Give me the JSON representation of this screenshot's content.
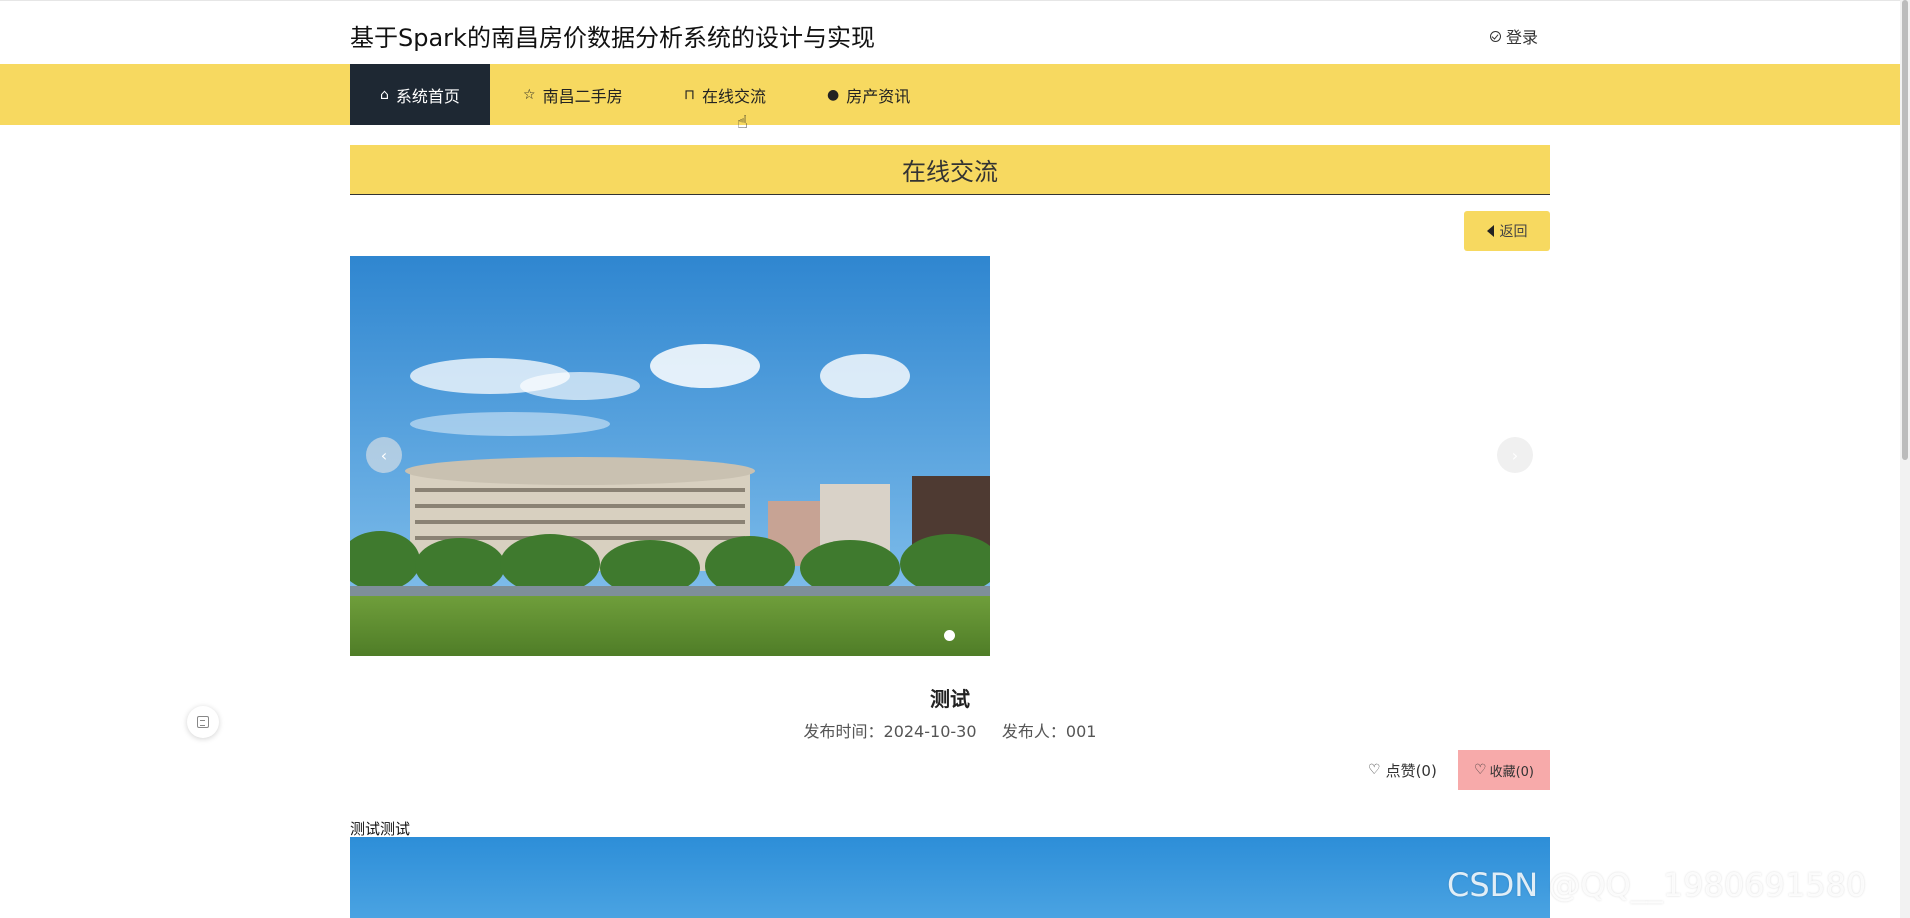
{
  "header": {
    "site_title": "基于Spark的南昌房价数据分析系统的设计与实现",
    "login_label": "登录"
  },
  "nav": {
    "items": [
      {
        "label": "系统首页",
        "icon": "home-icon",
        "active": true
      },
      {
        "label": "南昌二手房",
        "icon": "star-icon",
        "active": false
      },
      {
        "label": "在线交流",
        "icon": "lock-icon",
        "active": false
      },
      {
        "label": "房产资讯",
        "icon": "info-icon",
        "active": false
      }
    ]
  },
  "section": {
    "title": "在线交流",
    "back_label": "返回"
  },
  "carousel": {
    "image": "campus-building-photo",
    "prev_label": "‹",
    "next_label": "›",
    "dot_count": 1
  },
  "post": {
    "title": "测试",
    "meta": "发布时间：2024-10-30     发布人：001",
    "like_label": "点赞(0)",
    "favorite_label": "收藏(0)",
    "body": "测试测试"
  },
  "watermark": "CSDN @QQ__1980691580",
  "colors": {
    "accent": "#f7d960",
    "nav_active": "#1e2833",
    "favorite": "#f7aaaa"
  }
}
